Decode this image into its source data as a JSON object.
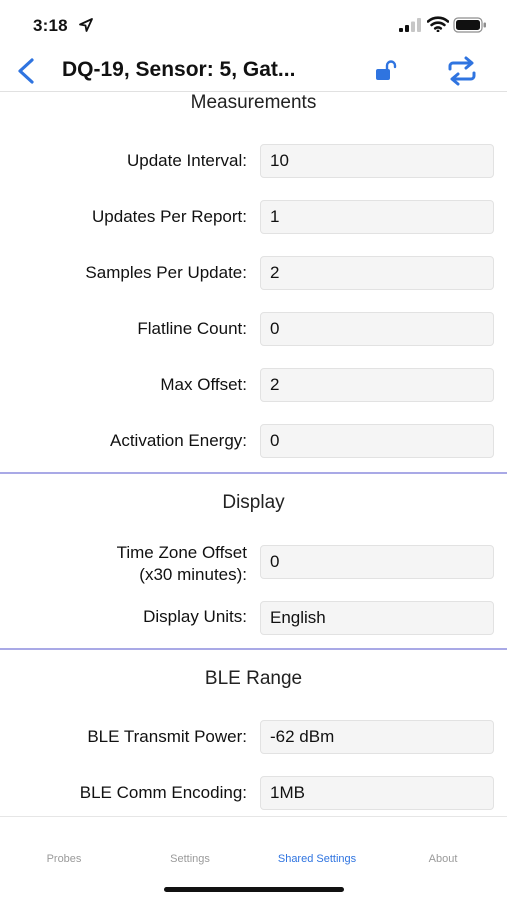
{
  "status_bar": {
    "time": "3:18"
  },
  "nav": {
    "title": "DQ-19, Sensor: 5, Gat..."
  },
  "sections": {
    "measurements": {
      "title": "Measurements",
      "rows": [
        {
          "label": "Update Interval:",
          "value": "10"
        },
        {
          "label": "Updates Per Report:",
          "value": "1"
        },
        {
          "label": "Samples Per Update:",
          "value": "2"
        },
        {
          "label": "Flatline Count:",
          "value": "0"
        },
        {
          "label": "Max Offset:",
          "value": "2"
        },
        {
          "label": "Activation Energy:",
          "value": "0"
        }
      ]
    },
    "display": {
      "title": "Display",
      "rows": [
        {
          "label_line1": "Time Zone Offset",
          "label_line2": "(x30 minutes):",
          "value": "0"
        },
        {
          "label": "Display Units:",
          "value": "English"
        }
      ]
    },
    "ble": {
      "title": "BLE Range",
      "rows": [
        {
          "label": "BLE Transmit Power:",
          "value": "-62 dBm"
        },
        {
          "label": "BLE Comm Encoding:",
          "value": "1MB"
        }
      ]
    }
  },
  "tabs": [
    {
      "label": "Probes",
      "active": false
    },
    {
      "label": "Settings",
      "active": false
    },
    {
      "label": "Shared Settings",
      "active": true
    },
    {
      "label": "About",
      "active": false
    }
  ],
  "icons": {
    "location": "location-arrow-icon",
    "signal": "cellular-signal-icon",
    "wifi": "wifi-icon",
    "battery": "battery-icon",
    "back": "chevron-left-icon",
    "lock": "unlocked-padlock-icon",
    "sync": "sync-arrows-icon"
  },
  "colors": {
    "accent": "#2f74e0",
    "divider": "#a9a9e6",
    "field_bg": "#f5f5f5"
  }
}
